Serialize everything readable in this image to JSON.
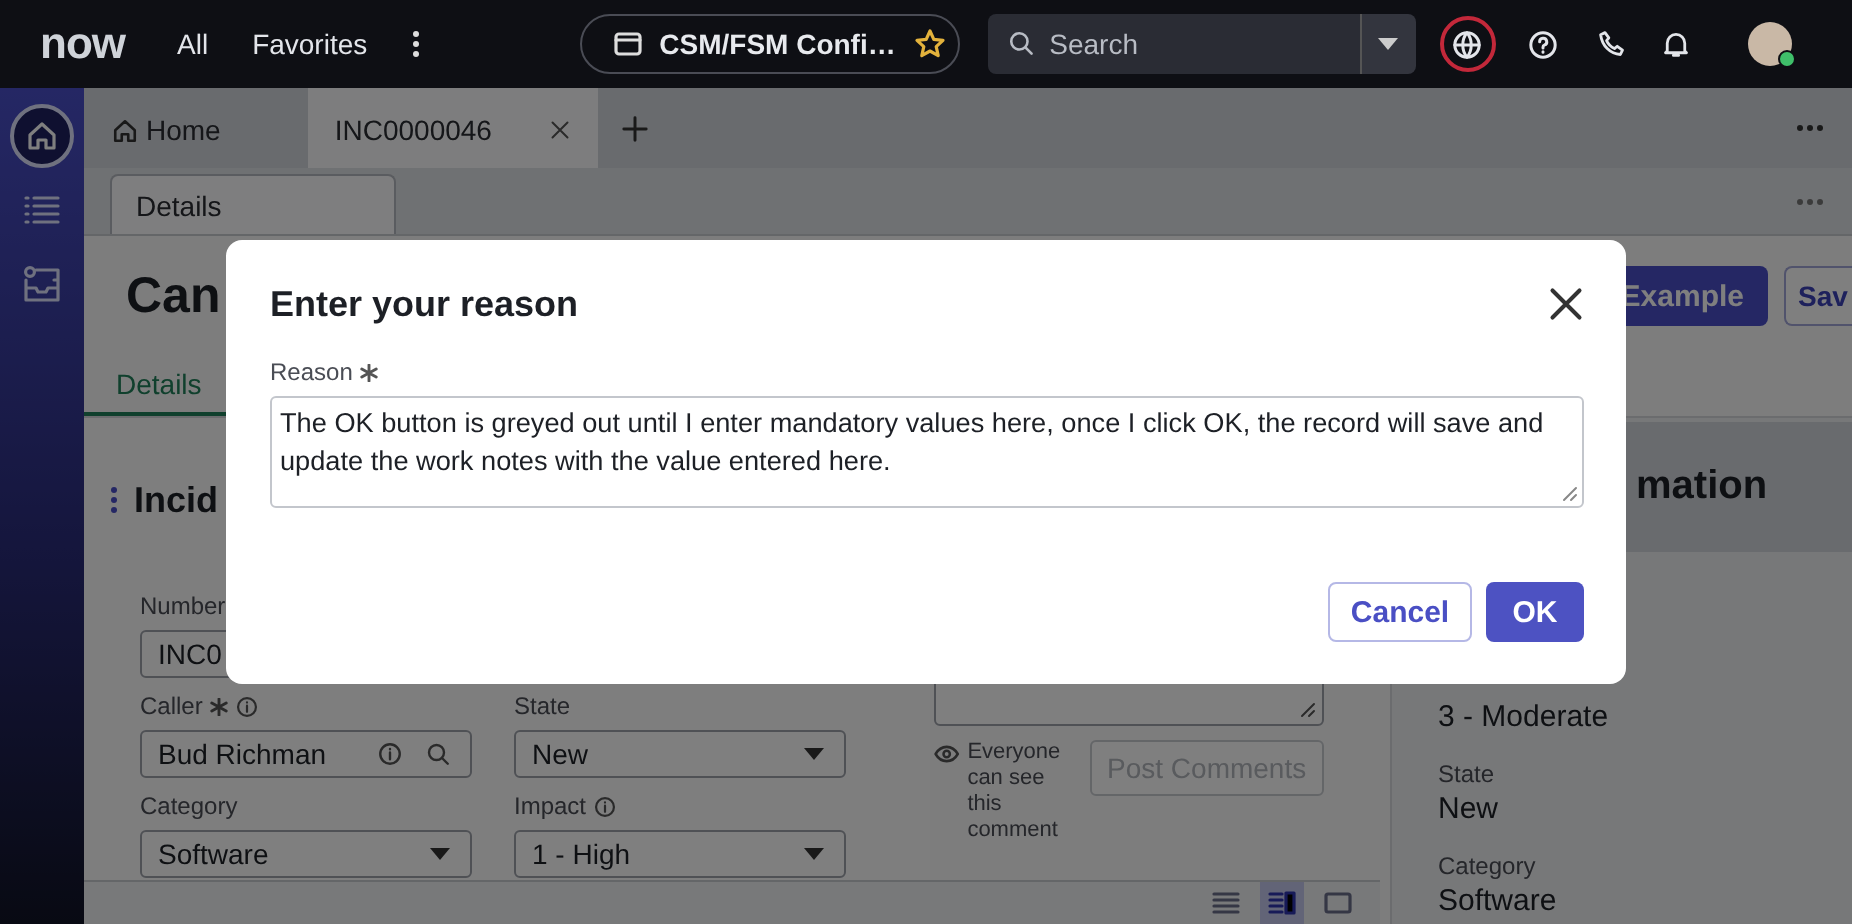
{
  "top_bar": {
    "logo": "now",
    "nav": [
      "All",
      "Favorites"
    ],
    "context": "CSM/FSM Confi…",
    "search": {
      "placeholder": "Search"
    }
  },
  "tabs": [
    {
      "label": "Home",
      "kind": "home",
      "selected": false
    },
    {
      "label": "INC0000046",
      "kind": "record",
      "selected": true
    }
  ],
  "sub_tabs": [
    {
      "label": "Details",
      "selected": true
    }
  ],
  "record": {
    "title": "Can",
    "actions": [
      {
        "label": "Example",
        "kind": "primary"
      },
      {
        "label": "Sav",
        "kind": "secondary"
      }
    ],
    "tabs": [
      {
        "label": "Details",
        "selected": true
      }
    ]
  },
  "form": {
    "heading": "Incid",
    "fields": [
      {
        "label": "Number",
        "value": "INC0",
        "kind": "text"
      },
      {
        "label": "Caller",
        "value": "Bud Richman",
        "kind": "reference",
        "required": true,
        "info": true
      },
      {
        "label": "State",
        "value": "New",
        "kind": "select"
      },
      {
        "label": "Category",
        "value": "Software",
        "kind": "select"
      },
      {
        "label": "Impact",
        "value": "1 - High",
        "kind": "select",
        "info": true
      }
    ]
  },
  "comments": {
    "visibility": "Everyone can see this comment",
    "button": {
      "label": "Post Comments",
      "disabled": true
    }
  },
  "info_panel": {
    "heading": "mation",
    "fields": [
      {
        "value": "3 - Moderate"
      },
      {
        "label": "State",
        "value": "New"
      },
      {
        "label": "Category",
        "value": "Software"
      }
    ]
  },
  "view_switch": [
    {
      "kind": "list",
      "selected": false
    },
    {
      "kind": "split",
      "selected": true
    },
    {
      "kind": "single",
      "selected": false
    }
  ],
  "dialog": {
    "title": "Enter your reason",
    "field": {
      "label": "Reason",
      "required": true,
      "value": "The OK button is greyed out until I enter mandatory values here, once I click OK, the record will save and update the work notes with the value entered here."
    },
    "buttons": [
      {
        "label": "Cancel",
        "kind": "secondary"
      },
      {
        "label": "OK",
        "kind": "primary"
      }
    ]
  }
}
